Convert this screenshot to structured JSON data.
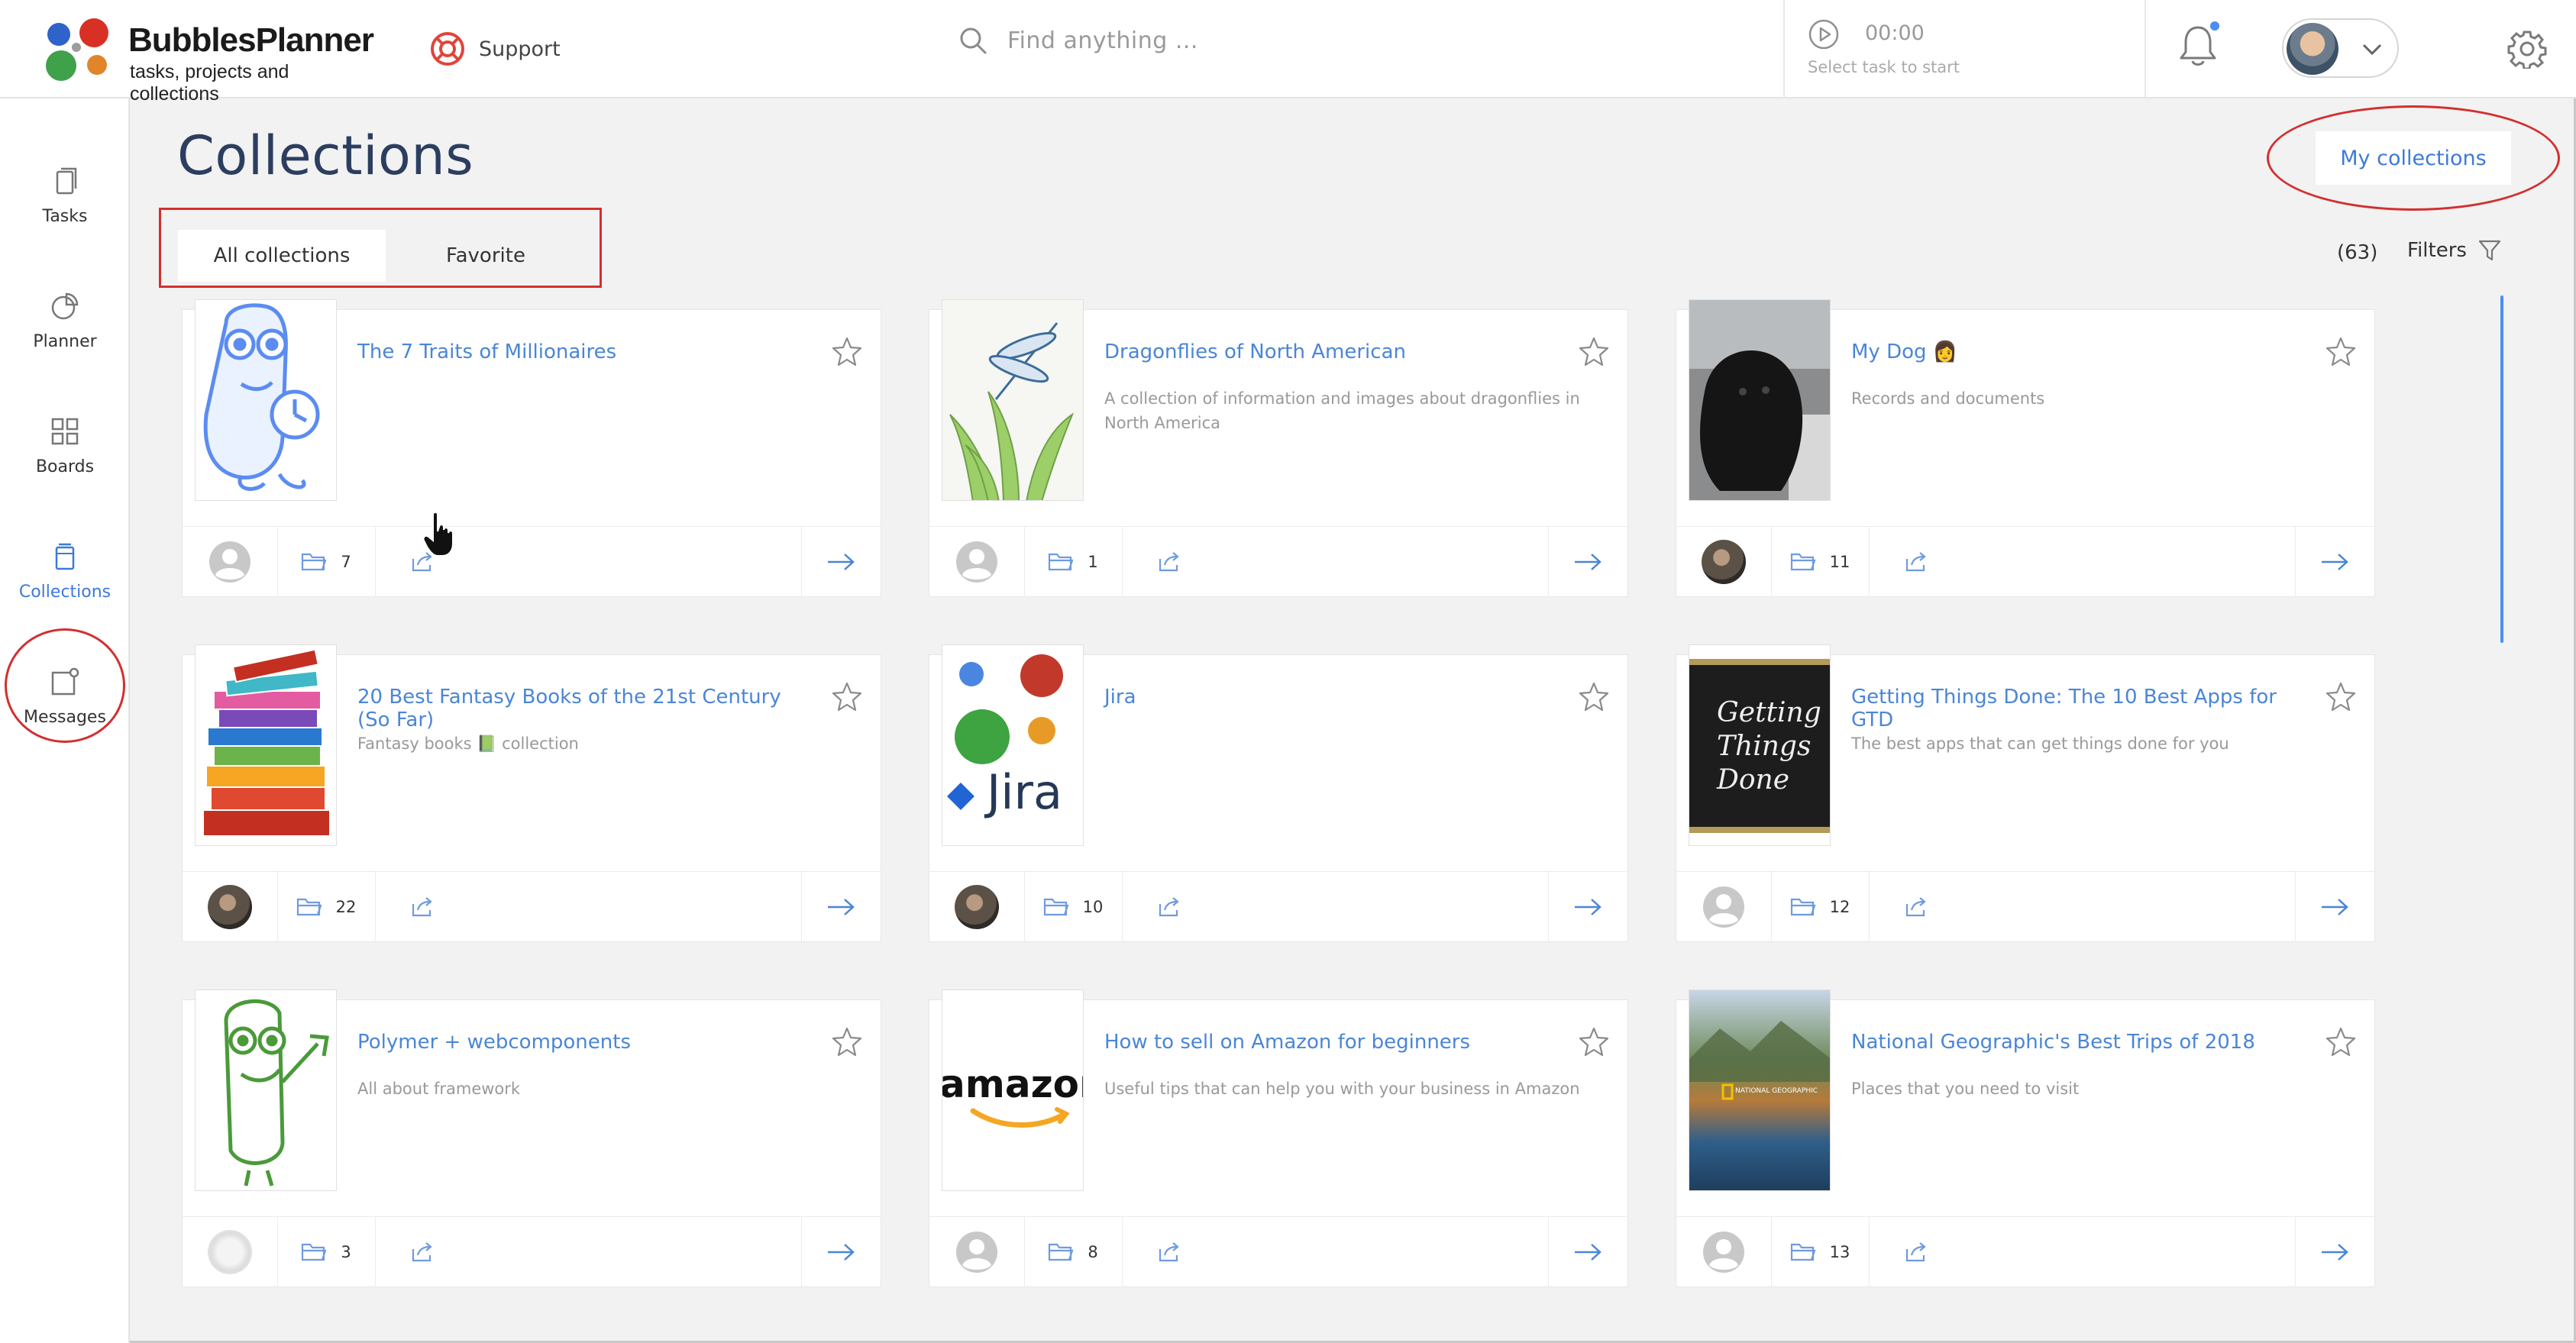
{
  "app": {
    "name": "BubblesPlanner",
    "tagline": "tasks, projects and collections",
    "support_label": "Support",
    "search_placeholder": "Find anything ...",
    "timer_time": "00:00",
    "timer_hint": "Select task to start"
  },
  "sidebar": {
    "items": [
      {
        "label": "Tasks",
        "icon": "tasks-icon"
      },
      {
        "label": "Planner",
        "icon": "planner-icon"
      },
      {
        "label": "Boards",
        "icon": "boards-icon"
      },
      {
        "label": "Collections",
        "icon": "collections-icon",
        "active": true
      },
      {
        "label": "Messages",
        "icon": "messages-icon"
      }
    ]
  },
  "page": {
    "title": "Collections",
    "my_collections_label": "My collections",
    "tabs": [
      {
        "label": "All collections",
        "active": true
      },
      {
        "label": "Favorite",
        "active": false
      }
    ],
    "count": "(63)",
    "filters_label": "Filters"
  },
  "colors": {
    "accent": "#3d7ad8",
    "annotation_red": "#d32f2f",
    "title": "#2c3e60"
  },
  "collections": [
    {
      "title": "The 7 Traits of Millionaires",
      "description": "",
      "folders": "7",
      "owner": "default",
      "thumb": "robot-blue"
    },
    {
      "title": "Dragonflies of North American",
      "description": "A collection of information and images about dragonflies in North America",
      "folders": "1",
      "owner": "default",
      "thumb": "dragonfly"
    },
    {
      "title": "My Dog 👩",
      "description": "Records and documents",
      "folders": "11",
      "owner": "photo",
      "thumb": "dog"
    },
    {
      "title": "20 Best Fantasy Books of the 21st Century (So Far)",
      "description": "Fantasy books 📗 collection",
      "folders": "22",
      "owner": "photo",
      "thumb": "books"
    },
    {
      "title": "Jira",
      "description": "",
      "folders": "10",
      "owner": "photo",
      "thumb": "jira"
    },
    {
      "title": "Getting Things Done: The 10 Best Apps for GTD",
      "description": "The best apps that can get things done for you",
      "folders": "12",
      "owner": "default",
      "thumb": "gtd"
    },
    {
      "title": "Polymer + webcomponents",
      "description": "All about framework",
      "folders": "3",
      "owner": "light",
      "thumb": "robot-green"
    },
    {
      "title": "How to sell on Amazon for beginners",
      "description": "Useful tips that can help you with your business in Amazon",
      "folders": "8",
      "owner": "default",
      "thumb": "amazon"
    },
    {
      "title": "National Geographic's Best Trips of 2018",
      "description": "Places that you need to visit",
      "folders": "13",
      "owner": "default",
      "thumb": "natgeo"
    }
  ],
  "thumb_text": {
    "jira": "Jira",
    "gtd": [
      "Getting",
      "Things",
      "Done"
    ],
    "amazon": "amazon",
    "natgeo": "NATIONAL GEOGRAPHIC"
  }
}
